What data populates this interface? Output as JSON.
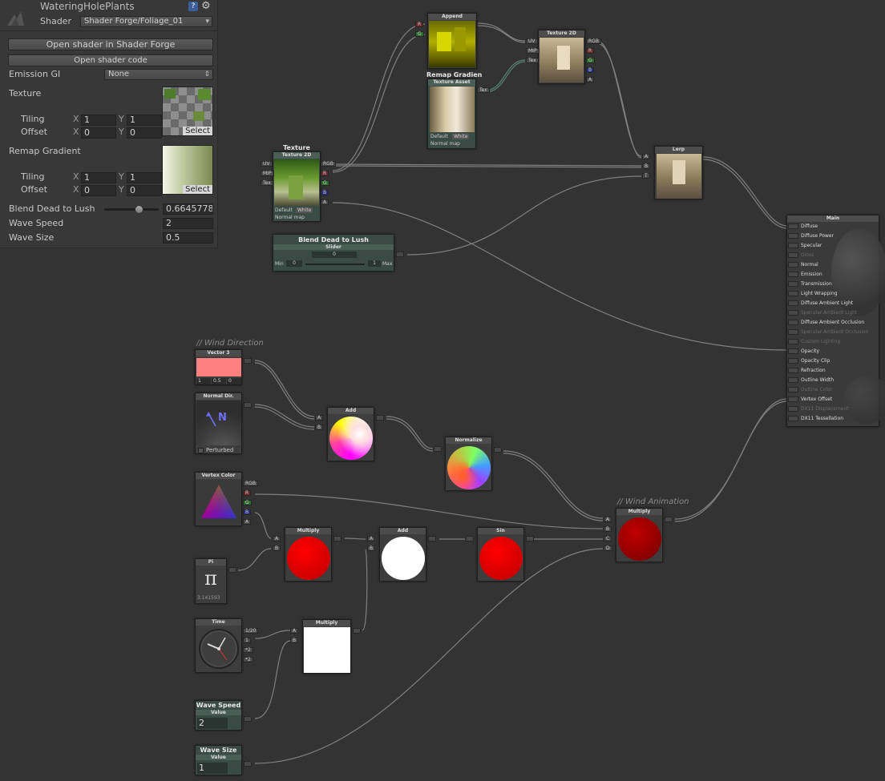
{
  "inspector": {
    "title": "WateringHolePlants",
    "shader_label": "Shader",
    "shader_value": "Shader Forge/Foliage_01",
    "open_forge_btn": "Open shader in Shader Forge",
    "open_code_btn": "Open shader code",
    "emission_gi_label": "Emission GI",
    "emission_gi_value": "None",
    "texture_label": "Texture",
    "tiling_label": "Tiling",
    "offset_label": "Offset",
    "x_label": "X",
    "y_label": "Y",
    "tex_tiling_x": "1",
    "tex_tiling_y": "1",
    "tex_offset_x": "0",
    "tex_offset_y": "0",
    "select_label": "Select",
    "remap_label": "Remap Gradient",
    "remap_tiling_x": "1",
    "remap_tiling_y": "1",
    "remap_offset_x": "0",
    "remap_offset_y": "0",
    "blend_label": "Blend Dead to Lush",
    "blend_value": "0.6645778",
    "blend_slider": 0.6645778,
    "wave_speed_label": "Wave Speed",
    "wave_speed_value": "2",
    "wave_size_label": "Wave Size",
    "wave_size_value": "0.5"
  },
  "ports": {
    "uv": "UV",
    "mip": "MIP",
    "tex": "Tex",
    "rgb": "RGB",
    "r": "R",
    "g": "G",
    "b": "B",
    "a": "A",
    "t": "T",
    "c": "C",
    "d": "D",
    "one_over_20": "1/20",
    "one": "1",
    "times2a": "*2",
    "times2b": "*2"
  },
  "nodes": {
    "append": "Append",
    "tex2d_top": "Texture 2D",
    "remap_tag": "Remap Gradien",
    "texture_asset": "Texture Asset",
    "default_lbl": "Default",
    "white_lbl": "White",
    "normal_map": "Normal map",
    "texture_tag": "Texture",
    "tex2d_main": "Texture 2D",
    "lerp": "Lerp",
    "blend_tag": "Blend Dead to Lush",
    "slider": "Slider",
    "slider_val": "0",
    "min_lbl": "Min",
    "min_val": "0",
    "max_lbl": "Max",
    "max_val": "1",
    "wind_dir_note": "// Wind Direction",
    "vector3": "Vector 3",
    "v3_x": "1",
    "v3_y": "0.5",
    "v3_z": "0",
    "normal_dir": "Normal Dir.",
    "normal_n": "N",
    "perturbed": "Perturbed",
    "add1": "Add",
    "normalize": "Normalize",
    "vertex_color": "Vertex Color",
    "wind_anim_note": "// Wind Animation",
    "multiply_big": "Multiply",
    "multiply1": "Multiply",
    "add2": "Add",
    "sin": "Sin",
    "pi": "Pi",
    "pi_glyph": "π",
    "pi_value": "3.141593",
    "time": "Time",
    "multiply2": "Multiply",
    "wave_speed_tag": "Wave Speed",
    "wave_speed_sub": "Value",
    "wave_speed_val": "2",
    "wave_size_tag": "Wave Size",
    "wave_size_sub": "Value",
    "wave_size_val": "1"
  },
  "main_node": {
    "title": "Main",
    "inputs": [
      {
        "label": "Diffuse",
        "dim": false
      },
      {
        "label": "Diffuse Power",
        "dim": false
      },
      {
        "label": "Specular",
        "dim": false
      },
      {
        "label": "Gloss",
        "dim": true
      },
      {
        "label": "Normal",
        "dim": false
      },
      {
        "label": "Emission",
        "dim": false
      },
      {
        "label": "Transmission",
        "dim": false
      },
      {
        "label": "Light Wrapping",
        "dim": false
      },
      {
        "label": "Diffuse Ambient Light",
        "dim": false
      },
      {
        "label": "Specular Ambient Light",
        "dim": true
      },
      {
        "label": "Diffuse Ambient Occlusion",
        "dim": false
      },
      {
        "label": "Specular Ambient Occlusion",
        "dim": true
      },
      {
        "label": "Custom Lighting",
        "dim": true
      },
      {
        "label": "Opacity",
        "dim": false
      },
      {
        "label": "Opacity Clip",
        "dim": false
      },
      {
        "label": "Refraction",
        "dim": false
      },
      {
        "label": "Outline Width",
        "dim": false
      },
      {
        "label": "Outline Color",
        "dim": true
      },
      {
        "label": "Vertex Offset",
        "dim": false
      },
      {
        "label": "DX11 Displacement",
        "dim": true
      },
      {
        "label": "DX11 Tessellation",
        "dim": false
      }
    ]
  },
  "colors": {
    "canvas": "#333333",
    "wire": "#8a8a8a",
    "vector3_swatch": "#ff8080",
    "red_ball": "#ff0000",
    "dark_red_ball": "#c00000"
  }
}
